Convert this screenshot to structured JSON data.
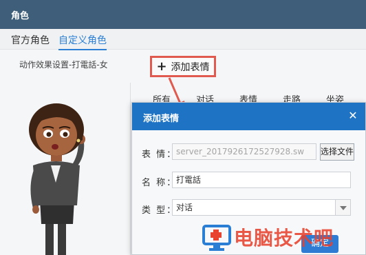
{
  "window": {
    "title": "角色"
  },
  "tabs": [
    {
      "label": "官方角色",
      "active": false
    },
    {
      "label": "自定义角色",
      "active": true
    }
  ],
  "action_caption": "动作效果设置-打電話-女",
  "add_button": {
    "label": "添加表情",
    "icon": "plus-icon"
  },
  "columns": [
    "所有",
    "对话",
    "表情",
    "走路",
    "坐姿"
  ],
  "dialog": {
    "title": "添加表情",
    "close_icon": "close-icon",
    "expression_label": "表 情：",
    "expression_value": "server_2017926172527928.sw",
    "browse_label": "选择文件...",
    "name_label": "名 称：",
    "name_value": "打電話",
    "type_label": "类 型：",
    "type_value": "对话",
    "ok_partial": "确定"
  },
  "watermark": {
    "text": "电脑技术吧"
  },
  "colors": {
    "titlebar": "#3f5e79",
    "dialog_header": "#1e73c4",
    "highlight_box": "#e05a4f",
    "tab_active": "#2a7fd4",
    "watermark": "#e8432e"
  }
}
